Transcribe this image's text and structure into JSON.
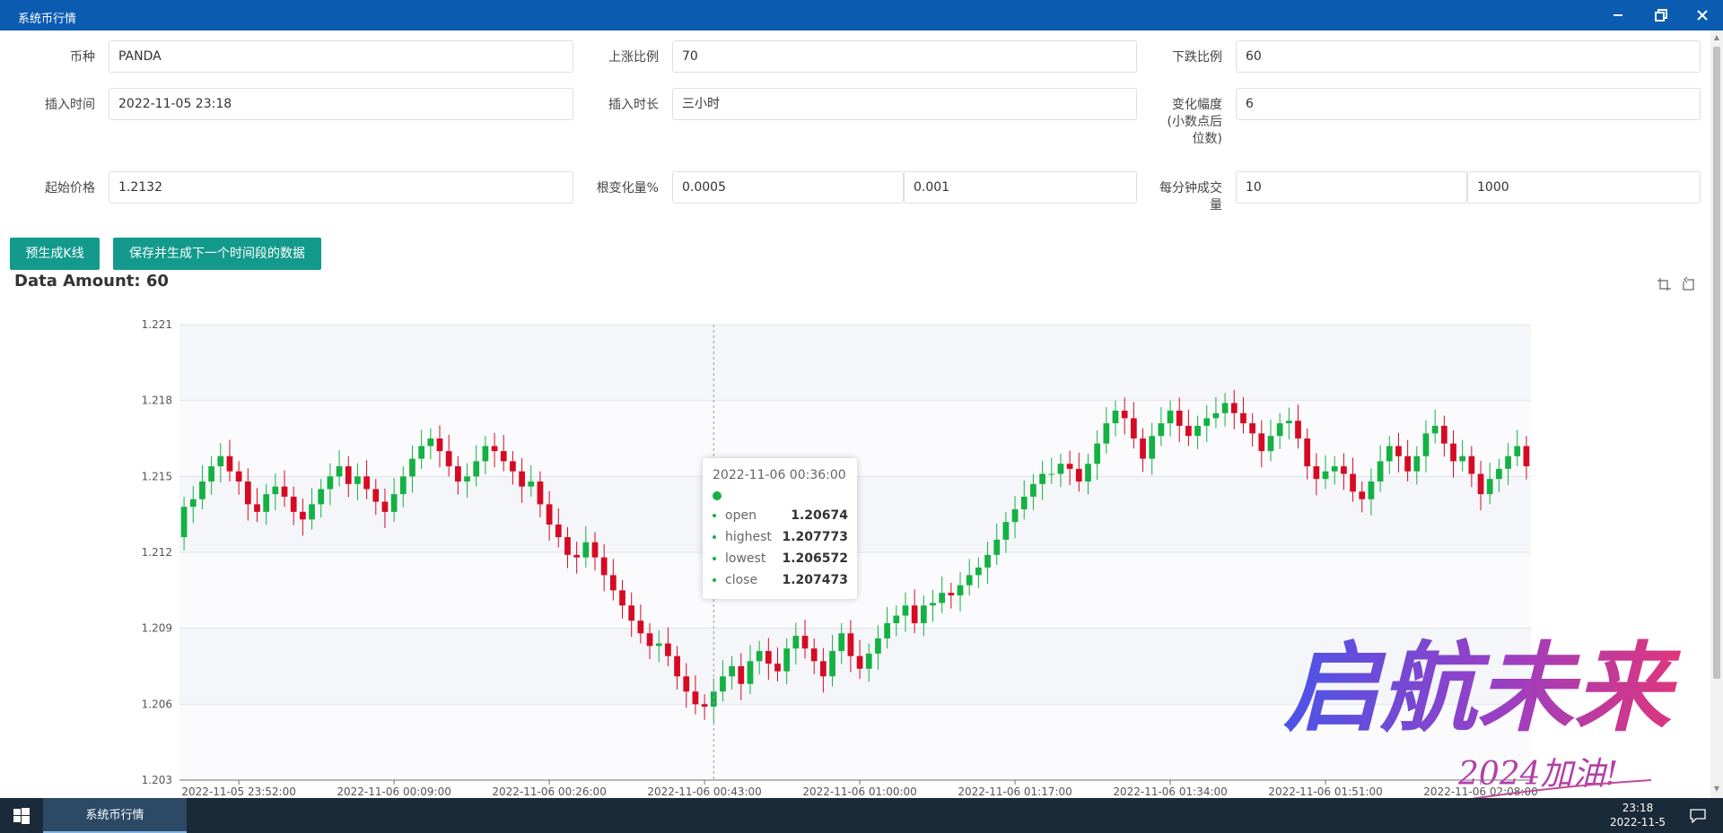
{
  "window": {
    "title": "系统币行情"
  },
  "form": {
    "coin": {
      "label": "币种",
      "value": "PANDA"
    },
    "rise": {
      "label": "上涨比例",
      "value": "70"
    },
    "fall": {
      "label": "下跌比例",
      "value": "60"
    },
    "insert_time": {
      "label": "插入时间",
      "value": "2022-11-05 23:18"
    },
    "insert_duration": {
      "label": "插入时长",
      "value": "三小时"
    },
    "change_range": {
      "label_lines": [
        "变化幅度",
        "(小数点后",
        "位数)"
      ],
      "value": "6"
    },
    "start_price": {
      "label": "起始价格",
      "value": "1.2132"
    },
    "root_change": {
      "label": "根变化量%",
      "min": "0.0005",
      "max": "0.001"
    },
    "volume_per_minute": {
      "label_lines": [
        "每分钟成交",
        "量"
      ],
      "min": "10",
      "max": "1000"
    }
  },
  "buttons": {
    "pregen": "预生成K线",
    "save_next": "保存并生成下一个时间段的数据"
  },
  "chart": {
    "title": "Data Amount: 60",
    "toolbox": [
      "zoom-icon",
      "zoom-reset-icon"
    ]
  },
  "chart_data": {
    "type": "candlestick",
    "title": "Data Amount: 60",
    "colors": {
      "up": "#14b143",
      "down": "#d60a22"
    },
    "ylim": [
      1.203,
      1.221
    ],
    "yticks": [
      "1.221",
      "1.218",
      "1.215",
      "1.212",
      "1.209",
      "1.206",
      "1.203"
    ],
    "xticks": [
      "2022-11-05 23:52:00",
      "2022-11-06 00:09:00",
      "2022-11-06 00:26:00",
      "2022-11-06 00:43:00",
      "2022-11-06 01:00:00",
      "2022-11-06 01:17:00",
      "2022-11-06 01:34:00",
      "2022-11-06 01:51:00",
      "2022-11-06 02:08:00"
    ],
    "grid": true,
    "close": [
      1.2138,
      1.2141,
      1.2148,
      1.2154,
      1.2158,
      1.2152,
      1.2148,
      1.2139,
      1.2136,
      1.2143,
      1.2146,
      1.2142,
      1.2136,
      1.2133,
      1.2139,
      1.2145,
      1.215,
      1.2154,
      1.2147,
      1.215,
      1.2145,
      1.214,
      1.2136,
      1.2143,
      1.215,
      1.2157,
      1.2162,
      1.2165,
      1.216,
      1.2154,
      1.2148,
      1.215,
      1.2156,
      1.2162,
      1.216,
      1.2156,
      1.2152,
      1.2146,
      1.2148,
      1.2139,
      1.2131,
      1.2126,
      1.2119,
      1.2118,
      1.2124,
      1.2118,
      1.2111,
      1.2105,
      1.2099,
      1.2093,
      1.2088,
      1.2083,
      1.2084,
      1.2079,
      1.2071,
      1.2065,
      1.206,
      1.2059,
      1.2065,
      1.2071,
      1.2075,
      1.2068,
      1.2077,
      1.2081,
      1.2076,
      1.2073,
      1.2082,
      1.2087,
      1.2082,
      1.2077,
      1.2071,
      1.2081,
      1.2088,
      1.2079,
      1.2074,
      1.208,
      1.2086,
      1.2092,
      1.2095,
      1.2099,
      1.2092,
      1.2099,
      1.21,
      1.2104,
      1.2103,
      1.2107,
      1.2111,
      1.2114,
      1.2119,
      1.2125,
      1.2132,
      1.2137,
      1.2142,
      1.2147,
      1.2151,
      1.2151,
      1.2155,
      1.2153,
      1.2148,
      1.2155,
      1.2163,
      1.2171,
      1.2176,
      1.2173,
      1.2165,
      1.2157,
      1.2166,
      1.2171,
      1.2176,
      1.217,
      1.2166,
      1.217,
      1.2173,
      1.2175,
      1.2179,
      1.2175,
      1.2171,
      1.2167,
      1.216,
      1.2166,
      1.2171,
      1.2172,
      1.2165,
      1.2154,
      1.2149,
      1.2152,
      1.2154,
      1.2151,
      1.2144,
      1.2141,
      1.2148,
      1.2156,
      1.2162,
      1.2158,
      1.2152,
      1.2158,
      1.2167,
      1.217,
      1.2163,
      1.2156,
      1.2158,
      1.2151,
      1.2143,
      1.2149,
      1.2153,
      1.2158,
      1.2162,
      1.2154
    ]
  },
  "tooltip": {
    "time": "2022-11-06 00:36:00",
    "rows": [
      {
        "name": "open",
        "value": "1.20674"
      },
      {
        "name": "highest",
        "value": "1.207773"
      },
      {
        "name": "lowest",
        "value": "1.206572"
      },
      {
        "name": "close",
        "value": "1.207473"
      }
    ]
  },
  "watermark": {
    "main": "启航未来",
    "sub": "2024加油!"
  },
  "taskbar": {
    "app": "系统币行情",
    "time": "23:18",
    "date": "2022-11-5"
  }
}
